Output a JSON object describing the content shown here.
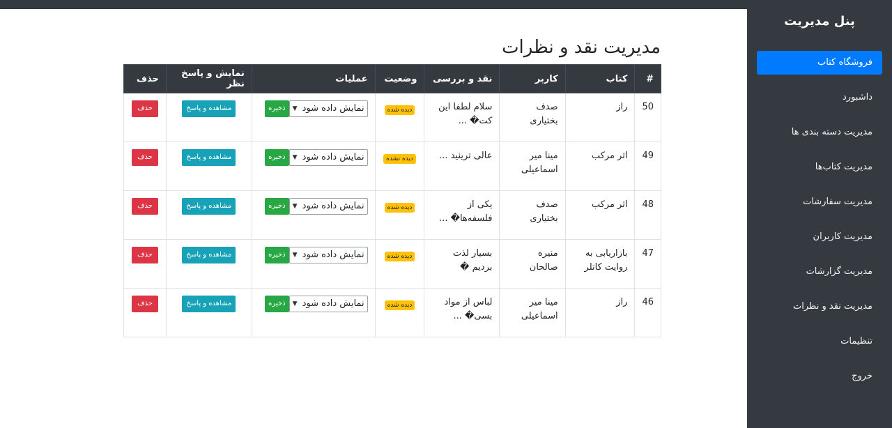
{
  "sidebar": {
    "title": "پنل مدیریت",
    "items": [
      {
        "label": "فروشگاه کتاب"
      },
      {
        "label": "داشبورد"
      },
      {
        "label": "مدیریت دسته بندی ها"
      },
      {
        "label": "مدیریت کتاب‌ها"
      },
      {
        "label": "مدیریت سفارشات"
      },
      {
        "label": "مدیریت کاربران"
      },
      {
        "label": "مدیریت گزارشات"
      },
      {
        "label": "مدیریت نقد و نظرات"
      },
      {
        "label": "تنظیمات"
      },
      {
        "label": "خروج"
      }
    ]
  },
  "page": {
    "title": "مدیریت نقد و نظرات"
  },
  "table": {
    "headers": {
      "num": "#",
      "book": "کتاب",
      "user": "کاربر",
      "review": "نقد و بررسی",
      "status": "وضعیت",
      "ops": "عملیات",
      "view": "نمایش و پاسخ نظر",
      "del": "حذف"
    },
    "rows": [
      {
        "id": "50",
        "book": "راز",
        "user": "صدف بختیاری",
        "review": "سلام لطفا این کت� ...",
        "status": "دیده شده",
        "select": "نمایش داده شود",
        "save": "ذخیره",
        "view": "مشاهده و پاسخ",
        "del": "حذف"
      },
      {
        "id": "49",
        "book": "اثر مرکب",
        "user": "مینا میر اسماعیلی",
        "review": "عالی ترینید ...",
        "status": "دیده نشده",
        "select": "نمایش داده شود",
        "save": "ذخیره",
        "view": "مشاهده و پاسخ",
        "del": "حذف"
      },
      {
        "id": "48",
        "book": "اثر مرکب",
        "user": "صدف بختیاری",
        "review": "یکی از فلسفه‌ها� ...",
        "status": "دیده شده",
        "select": "نمایش داده شود",
        "save": "ذخیره",
        "view": "مشاهده و پاسخ",
        "del": "حذف"
      },
      {
        "id": "47",
        "book": "بازاریابی به روایت کاتلر",
        "user": "منیره صالحان",
        "review": "بسیار لذت بردیم �",
        "status": "دیده شده",
        "select": "نمایش داده شود",
        "save": "ذخیره",
        "view": "مشاهده و پاسخ",
        "del": "حذف"
      },
      {
        "id": "46",
        "book": "راز",
        "user": "مینا میر اسماعیلی",
        "review": "لباس از مواد بسی� ...",
        "status": "دیده شده",
        "select": "نمایش داده شود",
        "save": "ذخیره",
        "view": "مشاهده و پاسخ",
        "del": "حذف"
      }
    ]
  },
  "colors": {
    "sidebar_bg": "#343a40",
    "active": "#007bff",
    "badge": "#ffc107",
    "save": "#28a745",
    "view": "#17a2b8",
    "delete": "#dc3545"
  }
}
